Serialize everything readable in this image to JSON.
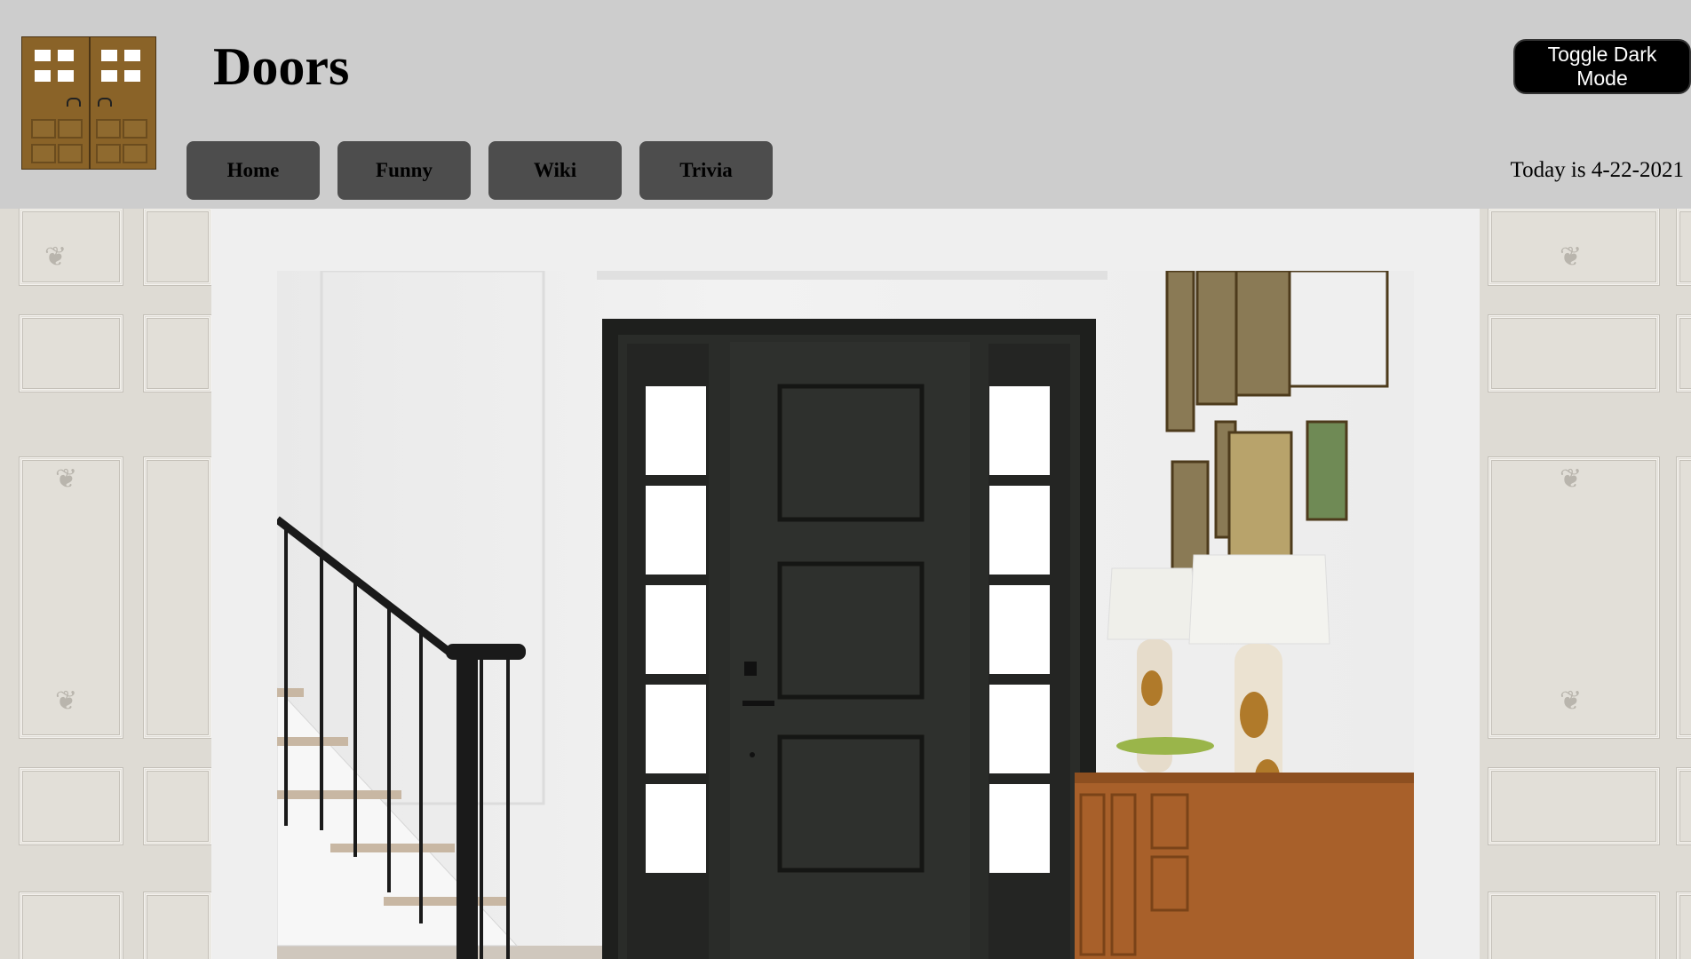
{
  "header": {
    "title": "Doors",
    "logo_icon": "double-door-logo-icon",
    "toggle_label": "Toggle Dark Mode",
    "date_text": "Today is 4-22-2021"
  },
  "nav": {
    "items": [
      {
        "label": "Home"
      },
      {
        "label": "Funny"
      },
      {
        "label": "Wiki"
      },
      {
        "label": "Trivia"
      }
    ]
  },
  "main": {
    "hero_image": "black-front-door-photo"
  },
  "colors": {
    "header_bg": "#cdcdcd",
    "nav_button_bg": "#4d4d4d",
    "toggle_bg": "#000000",
    "content_bg": "#efefef"
  }
}
